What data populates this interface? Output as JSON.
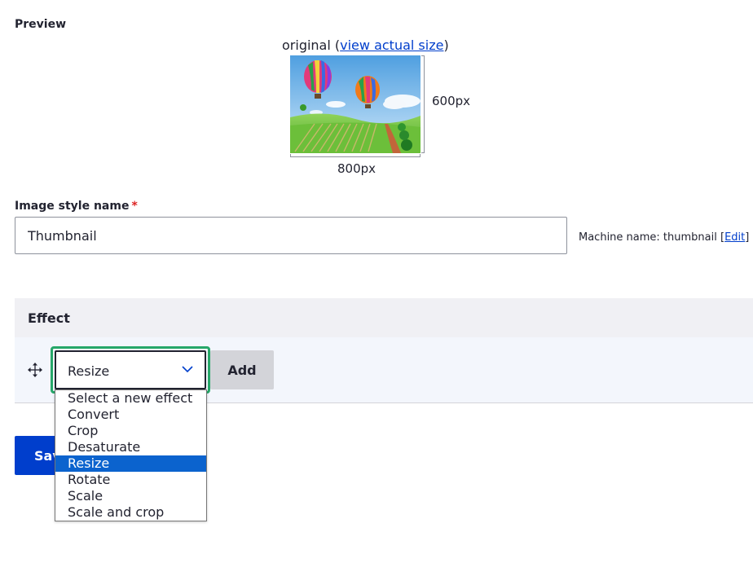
{
  "preview": {
    "label": "Preview",
    "caption_prefix": "original (",
    "caption_link": "view actual size",
    "caption_suffix": ")",
    "height_label": "600px",
    "width_label": "800px"
  },
  "style_name": {
    "label": "Image style name",
    "required_mark": "*",
    "value": "Thumbnail",
    "machine_name_prefix": "Machine name: thumbnail [",
    "machine_name_link": "Edit",
    "machine_name_suffix": "]"
  },
  "effects": {
    "header": "Effect",
    "selected": "Resize",
    "add_label": "Add",
    "options": [
      "Select a new effect",
      "Convert",
      "Crop",
      "Desaturate",
      "Resize",
      "Rotate",
      "Scale",
      "Scale and crop"
    ]
  },
  "save_label": "Save",
  "colors": {
    "accent": "#003ecc",
    "focus": "#26a769",
    "selected_option": "#0b63ce"
  }
}
